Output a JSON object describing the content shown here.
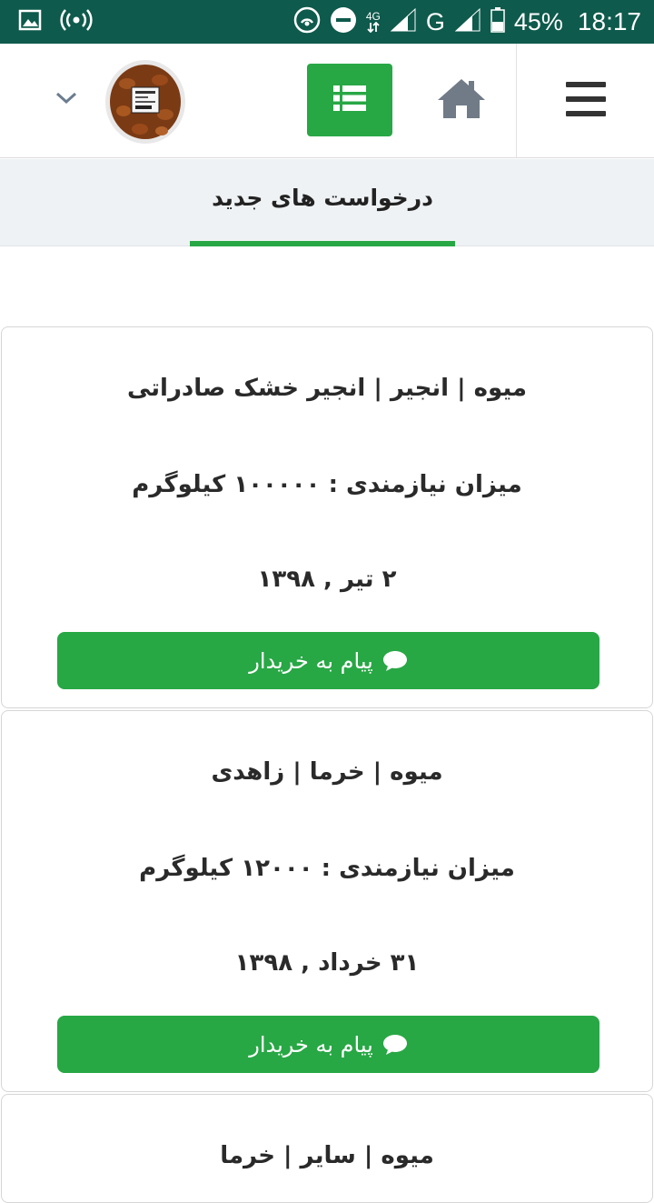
{
  "status_bar": {
    "network_type": "4G",
    "carrier_letter": "G",
    "battery": "45%",
    "time": "18:17",
    "background_color": "#0e5a4c"
  },
  "header": {
    "icons": [
      "hamburger-menu-icon",
      "home-icon",
      "list-icon",
      "chevron-down-icon"
    ],
    "accent_color": "#28a745"
  },
  "tabs": [
    {
      "label": "درخواست های جدید",
      "active": true
    }
  ],
  "requests": [
    {
      "product": "میوه | انجیر | انجیر خشک صادراتی",
      "quantity": "میزان نیازمندی : ۱۰۰۰۰۰ کیلوگرم",
      "date": "۲ تیر , ۱۳۹۸",
      "button_label": "پیام به خریدار"
    },
    {
      "product": "میوه | خرما | زاهدی",
      "quantity": "میزان نیازمندی : ۱۲۰۰۰ کیلوگرم",
      "date": "۳۱ خرداد , ۱۳۹۸",
      "button_label": "پیام به خریدار"
    },
    {
      "product": "میوه | سایر | خرما"
    }
  ]
}
